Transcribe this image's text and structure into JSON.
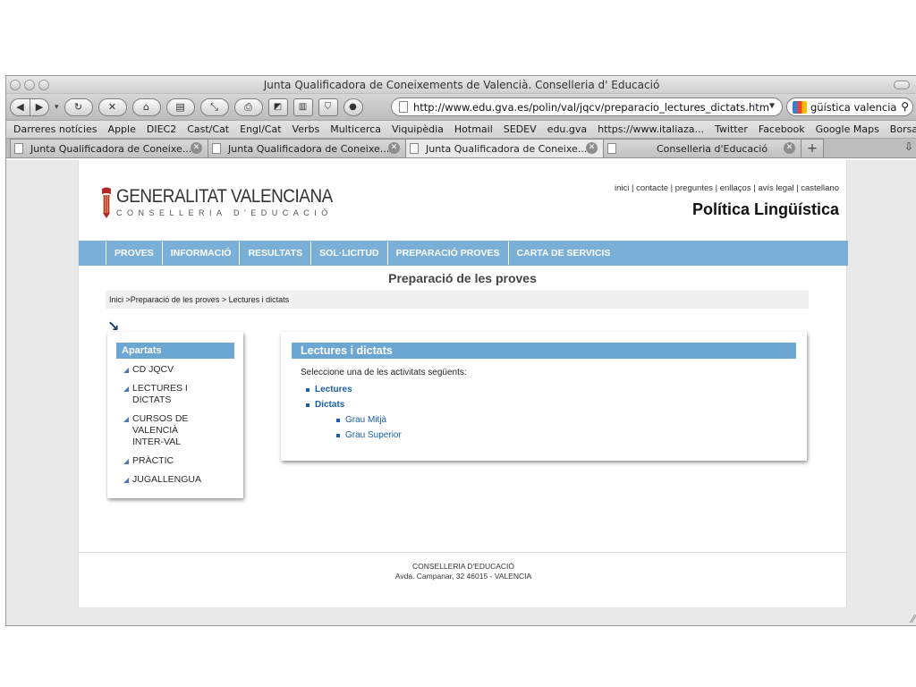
{
  "window": {
    "title": "Junta Qualificadora de Coneixements de Valencià. Conselleria d' Educació"
  },
  "toolbar": {
    "back_icon": "back-arrow-icon",
    "forward_icon": "forward-arrow-icon",
    "url": "http://www.edu.gva.es/polin/val/jqcv/preparacio_lectures_dictats.htm",
    "search_value": "güística valencia"
  },
  "bookmarks": [
    "Darreres notícies",
    "Apple",
    "DIEC2",
    "Cast/Cat",
    "Engl/Cat",
    "Verbs",
    "Multicerca",
    "Viquipèdia",
    "Hotmail",
    "SEDEV",
    "edu.gva",
    "https://www.italiaza...",
    "Twitter",
    "Facebook",
    "Google Maps",
    "Borsa Cat",
    "»"
  ],
  "tabs": [
    {
      "label": "Junta Qualificadora de Coneixe..."
    },
    {
      "label": "Junta Qualificadora de Coneixe..."
    },
    {
      "label": "Junta Qualificadora de Coneixe..."
    },
    {
      "label": "Conselleria d'Educació"
    }
  ],
  "site": {
    "logo_main": "GENERALITAT VALENCIANA",
    "logo_sub": "CONSELLERIA D'EDUCACIÓ",
    "toplinks": "inici | contacte | preguntes | enllaços | avís legal | castellano",
    "section_title": "Política Lingüística",
    "menu": [
      "PROVES",
      "INFORMACIÓ",
      "RESULTATS",
      "SOL·LICITUD",
      "PREPARACIÓ PROVES",
      "CARTA DE SERVICIS"
    ],
    "page_title": "Preparació de les proves",
    "breadcrumb": "Inici >Preparació de les proves > Lectures i dictats",
    "arrow": "↘"
  },
  "sidebar": {
    "header": "Apartats",
    "items": [
      {
        "label": "CD JQCV"
      },
      {
        "label": "LECTURES I DICTATS"
      },
      {
        "label": "CURSOS DE VALENCIÀ INTER-VAL"
      },
      {
        "label": "PRÀCTIC"
      },
      {
        "label": "JUGALLENGUA"
      }
    ]
  },
  "main": {
    "header": "Lectures i dictats",
    "intro": "Seleccione una de les activitats següents:",
    "links": {
      "lectures": "Lectures",
      "dictats": "Dictats",
      "grau_mitja": "Grau Mitjà",
      "grau_superior": "Grau Superior"
    }
  },
  "footer": {
    "line1": "CONSELLERIA D'EDUCACIÓ",
    "line2": "Avda. Campanar, 32 46015 - VALENCIA"
  }
}
